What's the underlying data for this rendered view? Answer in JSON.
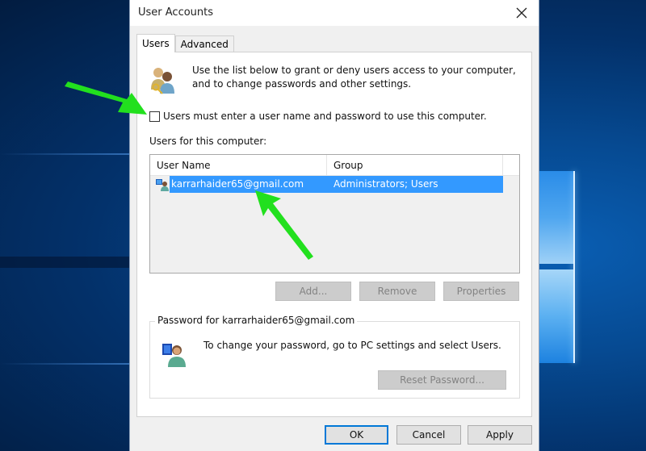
{
  "window": {
    "title": "User Accounts",
    "close_icon": "close-icon"
  },
  "tabs": [
    {
      "label": "Users",
      "active": true
    },
    {
      "label": "Advanced",
      "active": false
    }
  ],
  "users_tab": {
    "intro_text": "Use the list below to grant or deny users access to your computer, and to change passwords and other settings.",
    "intro_icon": "users-keys-icon",
    "require_password": {
      "label": "Users must enter a user name and password to use this computer.",
      "checked": false
    },
    "users_list_label": "Users for this computer:",
    "list": {
      "columns": [
        "User Name",
        "Group"
      ],
      "rows": [
        {
          "icon": "user-account-icon",
          "user_name": "karrarhaider65@gmail.com",
          "group": "Administrators; Users",
          "selected": true
        }
      ]
    },
    "buttons": {
      "add": {
        "label": "Add...",
        "enabled": false
      },
      "remove": {
        "label": "Remove",
        "enabled": false
      },
      "properties": {
        "label": "Properties",
        "enabled": false
      }
    },
    "password_group": {
      "legend": "Password for karrarhaider65@gmail.com",
      "icon": "user-password-icon",
      "text": "To change your password, go to PC settings and select Users.",
      "reset_button": {
        "label": "Reset Password...",
        "enabled": false
      }
    }
  },
  "footer": {
    "ok": "OK",
    "cancel": "Cancel",
    "apply": "Apply"
  },
  "annotations": {
    "arrow_color": "#22e01e",
    "arrows": [
      "points-to-require-password-checkbox",
      "points-to-selected-user"
    ]
  },
  "colors": {
    "selection": "#3399ff",
    "default_button_border": "#0078d7"
  }
}
